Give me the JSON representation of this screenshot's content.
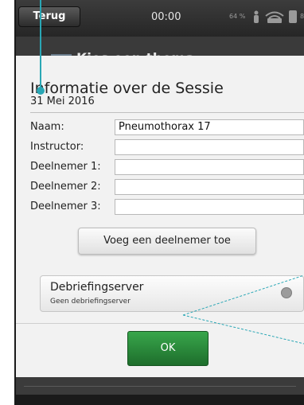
{
  "statusbar": {
    "back_label": "Terug",
    "time": "00:00",
    "battery_percent": "64 %",
    "battery_level": "89"
  },
  "background": {
    "title": "Kies een thema"
  },
  "dialog": {
    "title": "Informatie over de Sessie",
    "date": "31 Mei 2016",
    "fields": [
      {
        "label": "Naam:",
        "value": "Pneumothorax 17"
      },
      {
        "label": "Instructor:",
        "value": ""
      },
      {
        "label": "Deelnemer 1:",
        "value": ""
      },
      {
        "label": "Deelnemer 2:",
        "value": ""
      },
      {
        "label": "Deelnemer 3:",
        "value": ""
      }
    ],
    "add_participant_label": "Voeg een deelnemer toe",
    "server": {
      "title": "Debriefingserver",
      "subtitle": "Geen debriefingserver"
    },
    "ok_label": "OK"
  },
  "colors": {
    "callout": "#2aa7b5",
    "ok_green": "#2a8a3c"
  }
}
